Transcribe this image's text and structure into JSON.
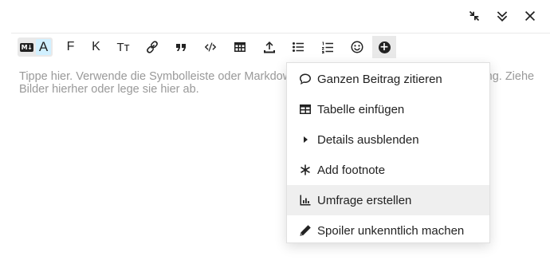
{
  "window_controls": [
    {
      "name": "collapse-icon"
    },
    {
      "name": "minimize-icon"
    },
    {
      "name": "close-icon"
    }
  ],
  "toolbar": {
    "markdown_icon_label": "M↓",
    "richtext_label": "A",
    "bold_label": "F",
    "italic_label": "K",
    "heading_label": "Tт",
    "icons": [
      "link-icon",
      "quote-icon",
      "code-icon",
      "table-icon",
      "upload-icon",
      "bullet-list-icon",
      "numbered-list-icon",
      "emoji-icon",
      "plus-icon"
    ],
    "plus_label": "+"
  },
  "editor": {
    "placeholder": "Tippe hier. Verwende die Symbolleiste oder Markdown, BBCode oder HTML zur Formatierung. Ziehe Bilder hierher oder lege sie hier ab."
  },
  "menu": {
    "items": [
      {
        "label": "Ganzen Beitrag zitieren",
        "icon": "speech-bubble-icon"
      },
      {
        "label": "Tabelle einfügen",
        "icon": "table-icon"
      },
      {
        "label": "Details ausblenden",
        "icon": "caret-right-icon"
      },
      {
        "label": "Add footnote",
        "icon": "asterisk-icon"
      },
      {
        "label": "Umfrage erstellen",
        "icon": "chart-bar-icon",
        "highlighted": true
      },
      {
        "label": "Spoiler unkenntlich machen",
        "icon": "pencil-icon"
      }
    ]
  },
  "colors": {
    "richtext_active": "#d1f0ff",
    "toggle_bg": "#e9e9e9",
    "menu_hover": "#efefef",
    "placeholder_text": "#999999"
  }
}
